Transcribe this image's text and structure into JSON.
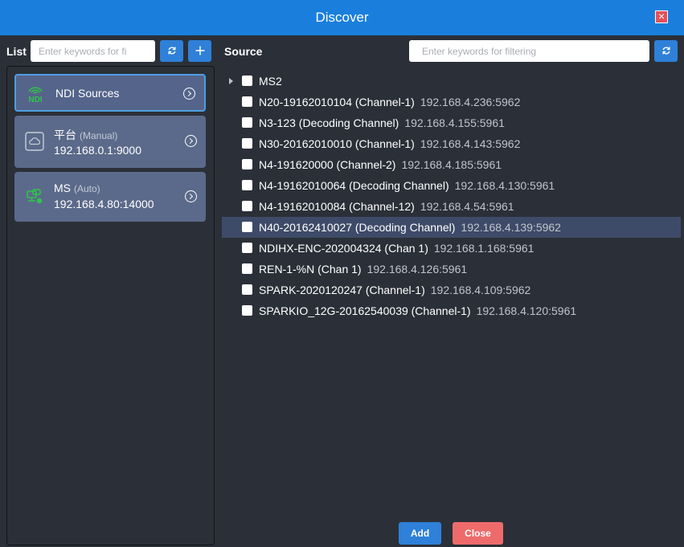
{
  "dialog": {
    "title": "Discover"
  },
  "list": {
    "label": "List",
    "search_placeholder": "Enter keywords for fi",
    "cards": [
      {
        "name": "NDI Sources",
        "type": "",
        "address": "",
        "icon": "ndi-icon",
        "active": true
      },
      {
        "name": "平台",
        "type": "(Manual)",
        "address": "192.168.0.1:9000",
        "icon": "cloud-icon",
        "active": false
      },
      {
        "name": "MS",
        "type": "(Auto)",
        "address": "192.168.4.80:14000",
        "icon": "media-server-icon",
        "active": false
      }
    ]
  },
  "source": {
    "label": "Source",
    "search_placeholder": "Enter keywords for filtering",
    "rows": [
      {
        "name": "MS2",
        "address": "",
        "expandable": true
      },
      {
        "name": "N20-19162010104 (Channel-1)",
        "address": "192.168.4.236:5962"
      },
      {
        "name": "N3-123 (Decoding Channel)",
        "address": "192.168.4.155:5961"
      },
      {
        "name": "N30-20162010010 (Channel-1)",
        "address": "192.168.4.143:5962"
      },
      {
        "name": "N4-191620000 (Channel-2)",
        "address": "192.168.4.185:5961"
      },
      {
        "name": "N4-19162010064 (Decoding Channel)",
        "address": "192.168.4.130:5961"
      },
      {
        "name": "N4-19162010084 (Channel-12)",
        "address": "192.168.4.54:5961"
      },
      {
        "name": "N40-20162410027 (Decoding Channel)",
        "address": "192.168.4.139:5962",
        "highlighted": true
      },
      {
        "name": "NDIHX-ENC-202004324 (Chan 1)",
        "address": "192.168.1.168:5961"
      },
      {
        "name": "REN-1-%N (Chan 1)",
        "address": "192.168.4.126:5961"
      },
      {
        "name": "SPARK-2020120247 (Channel-1)",
        "address": "192.168.4.109:5962"
      },
      {
        "name": "SPARKIO_12G-20162540039 (Channel-1)",
        "address": "192.168.4.120:5961"
      }
    ]
  },
  "buttons": {
    "add": "Add",
    "close": "Close"
  },
  "colors": {
    "titlebar": "#1a7fdc",
    "accent_blue": "#2f80d8",
    "close_red": "#ef6b6b",
    "ndi_green": "#2ec44a",
    "card": "#5b6a8a",
    "highlight_row": "#3e4b68"
  }
}
